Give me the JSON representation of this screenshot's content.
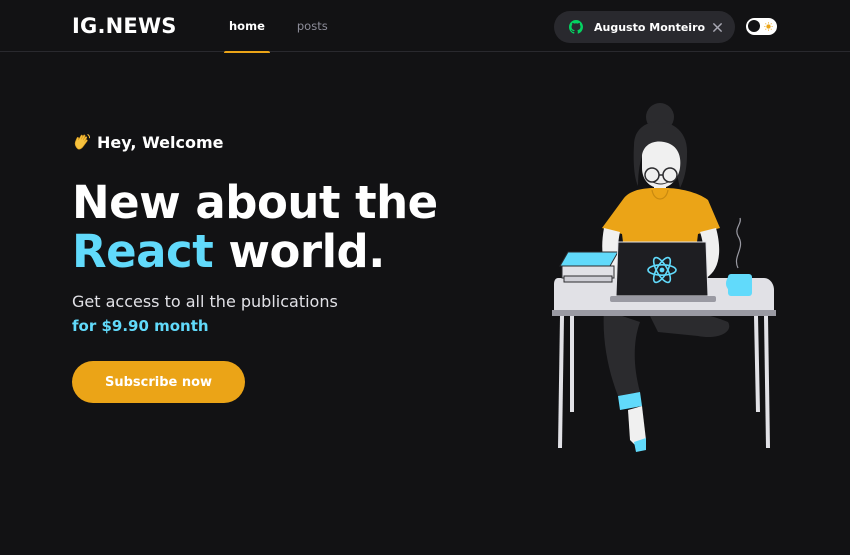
{
  "header": {
    "logo": "IG.NEWS",
    "nav": [
      {
        "label": "home",
        "active": true
      },
      {
        "label": "posts",
        "active": false
      }
    ],
    "user": {
      "name": "Augusto Monteiro",
      "provider_icon": "github-icon",
      "provider_icon_color": "#04d361",
      "close_icon": "close-icon"
    },
    "theme_toggle": {
      "icon": "sun-icon"
    }
  },
  "hero": {
    "greeting_icon": "waving-hand-icon",
    "greeting": "Hey, Welcome",
    "headline_line1": "New about the",
    "headline_accent": "React",
    "headline_rest": "world.",
    "subtext": "Get access to all the publications",
    "price": "for $9.90 month",
    "cta": "Subscribe now"
  },
  "illustration": {
    "name": "woman-with-laptop-illustration"
  },
  "colors": {
    "background": "#121214",
    "accent_yellow": "#eba417",
    "accent_cyan": "#61dafb",
    "chip_bg": "#29292e"
  }
}
